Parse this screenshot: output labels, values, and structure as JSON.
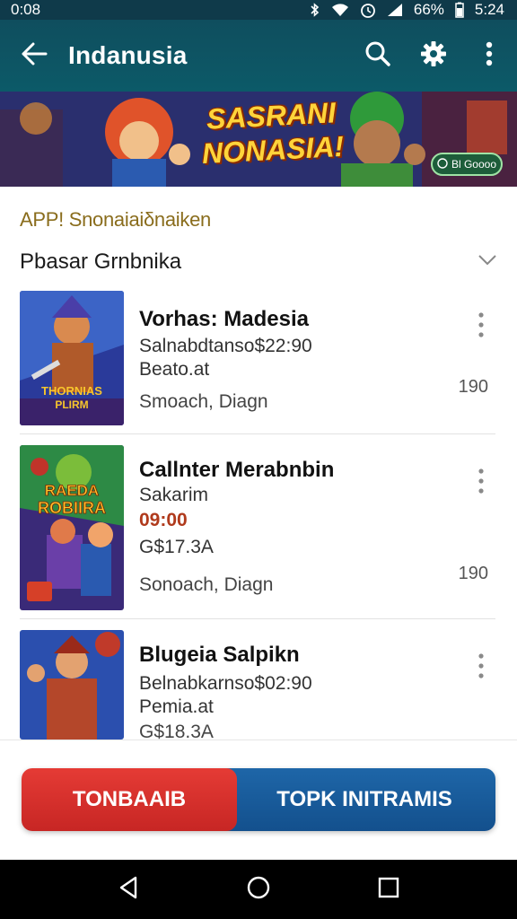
{
  "status_bar": {
    "time": "0:08",
    "battery": "66%",
    "clock": "5:24"
  },
  "app_bar": {
    "title": "Indanusia",
    "icons": [
      "back-arrow-icon",
      "search-icon",
      "gear-icon",
      "more-vert-icon"
    ]
  },
  "banner": {
    "title_line1": "SASRANI",
    "title_line2": "NONASIA!",
    "badge": "Bl Goooo"
  },
  "section": {
    "heading": "APP! Snonaiaiδnaiken",
    "filter_label": "Pbasar Grnbnika"
  },
  "items": [
    {
      "title": "Vorhas: Madesia",
      "line1": "Salnabdtanso$22:90",
      "line2": "Beato.at",
      "meta": "Smoach, Diagn",
      "count": "190",
      "thumb_caption1": "THORNIAS",
      "thumb_caption2": "PLIRM"
    },
    {
      "title": "Callnter Merabnbin",
      "line1": "Sakarim",
      "price_red": "09:00",
      "line2": "G$17.3A",
      "meta": "Sonoach, Diagn",
      "count": "190",
      "thumb_caption1": "RAEDA",
      "thumb_caption2": "ROBIIRA"
    },
    {
      "title": "Blugeia Salpikn",
      "line1": "Belnabkarnso$02:90",
      "line2": "Pemia.at",
      "meta": "G$18.3A"
    }
  ],
  "actions": {
    "left_label": "TONBAAIB",
    "right_label": "TOPK INITRAMIS"
  },
  "colors": {
    "app_bar": "#0c5a68",
    "status_bar": "#0f3a4a",
    "action_red": "#d6302d",
    "action_blue": "#165a99",
    "section_heading": "#8a6d1d"
  }
}
